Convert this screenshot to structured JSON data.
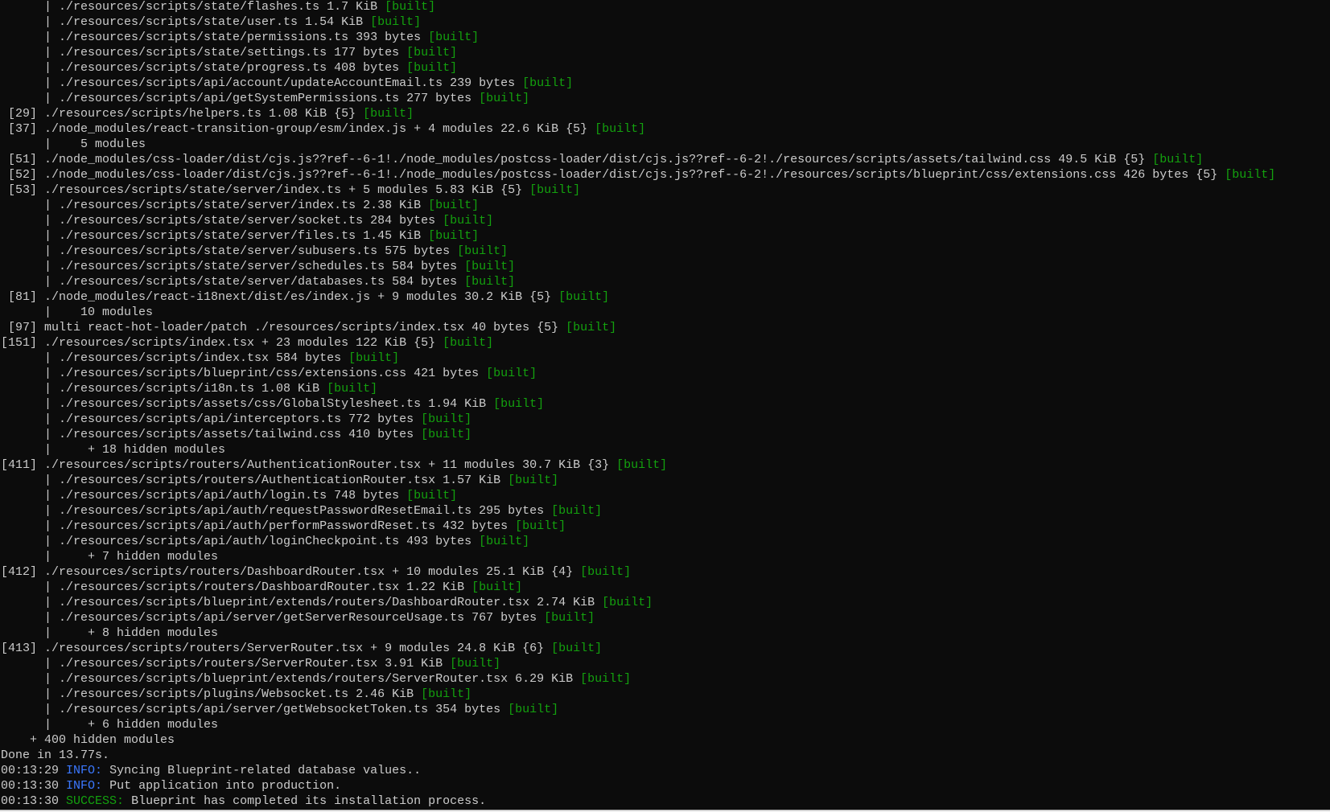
{
  "terminal": {
    "colors": {
      "background": "#0c0c0c",
      "foreground": "#cccccc",
      "status_built": "#13a10e"
    },
    "output": [
      {
        "text": "      | ./resources/scripts/state/flashes.ts 1.7 KiB",
        "status": "[built]"
      },
      {
        "text": "      | ./resources/scripts/state/user.ts 1.54 KiB",
        "status": "[built]"
      },
      {
        "text": "      | ./resources/scripts/state/permissions.ts 393 bytes",
        "status": "[built]"
      },
      {
        "text": "      | ./resources/scripts/state/settings.ts 177 bytes",
        "status": "[built]"
      },
      {
        "text": "      | ./resources/scripts/state/progress.ts 408 bytes",
        "status": "[built]"
      },
      {
        "text": "      | ./resources/scripts/api/account/updateAccountEmail.ts 239 bytes",
        "status": "[built]"
      },
      {
        "text": "      | ./resources/scripts/api/getSystemPermissions.ts 277 bytes",
        "status": "[built]"
      },
      {
        "text": " [29] ./resources/scripts/helpers.ts 1.08 KiB {5}",
        "status": "[built]"
      },
      {
        "text": " [37] ./node_modules/react-transition-group/esm/index.js + 4 modules 22.6 KiB {5}",
        "status": "[built]"
      },
      {
        "text": "      |    5 modules"
      },
      {
        "text": " [51] ./node_modules/css-loader/dist/cjs.js??ref--6-1!./node_modules/postcss-loader/dist/cjs.js??ref--6-2!./resources/scripts/assets/tailwind.css 49.5 KiB {5}",
        "status": "[built]"
      },
      {
        "text": " [52] ./node_modules/css-loader/dist/cjs.js??ref--6-1!./node_modules/postcss-loader/dist/cjs.js??ref--6-2!./resources/scripts/blueprint/css/extensions.css 426 bytes {5}",
        "status": "[built]"
      },
      {
        "text": " [53] ./resources/scripts/state/server/index.ts + 5 modules 5.83 KiB {5}",
        "status": "[built]"
      },
      {
        "text": "      | ./resources/scripts/state/server/index.ts 2.38 KiB",
        "status": "[built]"
      },
      {
        "text": "      | ./resources/scripts/state/server/socket.ts 284 bytes",
        "status": "[built]"
      },
      {
        "text": "      | ./resources/scripts/state/server/files.ts 1.45 KiB",
        "status": "[built]"
      },
      {
        "text": "      | ./resources/scripts/state/server/subusers.ts 575 bytes",
        "status": "[built]"
      },
      {
        "text": "      | ./resources/scripts/state/server/schedules.ts 584 bytes",
        "status": "[built]"
      },
      {
        "text": "      | ./resources/scripts/state/server/databases.ts 584 bytes",
        "status": "[built]"
      },
      {
        "text": " [81] ./node_modules/react-i18next/dist/es/index.js + 9 modules 30.2 KiB {5}",
        "status": "[built]"
      },
      {
        "text": "      |    10 modules"
      },
      {
        "text": " [97] multi react-hot-loader/patch ./resources/scripts/index.tsx 40 bytes {5}",
        "status": "[built]"
      },
      {
        "text": "[151] ./resources/scripts/index.tsx + 23 modules 122 KiB {5}",
        "status": "[built]"
      },
      {
        "text": "      | ./resources/scripts/index.tsx 584 bytes",
        "status": "[built]"
      },
      {
        "text": "      | ./resources/scripts/blueprint/css/extensions.css 421 bytes",
        "status": "[built]"
      },
      {
        "text": "      | ./resources/scripts/i18n.ts 1.08 KiB",
        "status": "[built]"
      },
      {
        "text": "      | ./resources/scripts/assets/css/GlobalStylesheet.ts 1.94 KiB",
        "status": "[built]"
      },
      {
        "text": "      | ./resources/scripts/api/interceptors.ts 772 bytes",
        "status": "[built]"
      },
      {
        "text": "      | ./resources/scripts/assets/tailwind.css 410 bytes",
        "status": "[built]"
      },
      {
        "text": "      |     + 18 hidden modules"
      },
      {
        "text": "[411] ./resources/scripts/routers/AuthenticationRouter.tsx + 11 modules 30.7 KiB {3}",
        "status": "[built]"
      },
      {
        "text": "      | ./resources/scripts/routers/AuthenticationRouter.tsx 1.57 KiB",
        "status": "[built]"
      },
      {
        "text": "      | ./resources/scripts/api/auth/login.ts 748 bytes",
        "status": "[built]"
      },
      {
        "text": "      | ./resources/scripts/api/auth/requestPasswordResetEmail.ts 295 bytes",
        "status": "[built]"
      },
      {
        "text": "      | ./resources/scripts/api/auth/performPasswordReset.ts 432 bytes",
        "status": "[built]"
      },
      {
        "text": "      | ./resources/scripts/api/auth/loginCheckpoint.ts 493 bytes",
        "status": "[built]"
      },
      {
        "text": "      |     + 7 hidden modules"
      },
      {
        "text": "[412] ./resources/scripts/routers/DashboardRouter.tsx + 10 modules 25.1 KiB {4}",
        "status": "[built]"
      },
      {
        "text": "      | ./resources/scripts/routers/DashboardRouter.tsx 1.22 KiB",
        "status": "[built]"
      },
      {
        "text": "      | ./resources/scripts/blueprint/extends/routers/DashboardRouter.tsx 2.74 KiB",
        "status": "[built]"
      },
      {
        "text": "      | ./resources/scripts/api/server/getServerResourceUsage.ts 767 bytes",
        "status": "[built]"
      },
      {
        "text": "      |     + 8 hidden modules"
      },
      {
        "text": "[413] ./resources/scripts/routers/ServerRouter.tsx + 9 modules 24.8 KiB {6}",
        "status": "[built]"
      },
      {
        "text": "      | ./resources/scripts/routers/ServerRouter.tsx 3.91 KiB",
        "status": "[built]"
      },
      {
        "text": "      | ./resources/scripts/blueprint/extends/routers/ServerRouter.tsx 6.29 KiB",
        "status": "[built]"
      },
      {
        "text": "      | ./resources/scripts/plugins/Websocket.ts 2.46 KiB",
        "status": "[built]"
      },
      {
        "text": "      | ./resources/scripts/api/server/getWebsocketToken.ts 354 bytes",
        "status": "[built]"
      },
      {
        "text": "      |     + 6 hidden modules"
      },
      {
        "text": "    + 400 hidden modules"
      },
      {
        "text": "Done in 13.77s."
      }
    ],
    "log": [
      {
        "time": "00:13:29",
        "level": "INFO:",
        "level_color": "#3b78ff",
        "message": "Syncing Blueprint-related database values.."
      },
      {
        "time": "00:13:30",
        "level": "INFO:",
        "level_color": "#3b78ff",
        "message": "Put application into production."
      },
      {
        "time": "00:13:30",
        "level": "SUCCESS:",
        "level_color": "#13a10e",
        "message": "Blueprint has completed its installation process."
      }
    ]
  }
}
